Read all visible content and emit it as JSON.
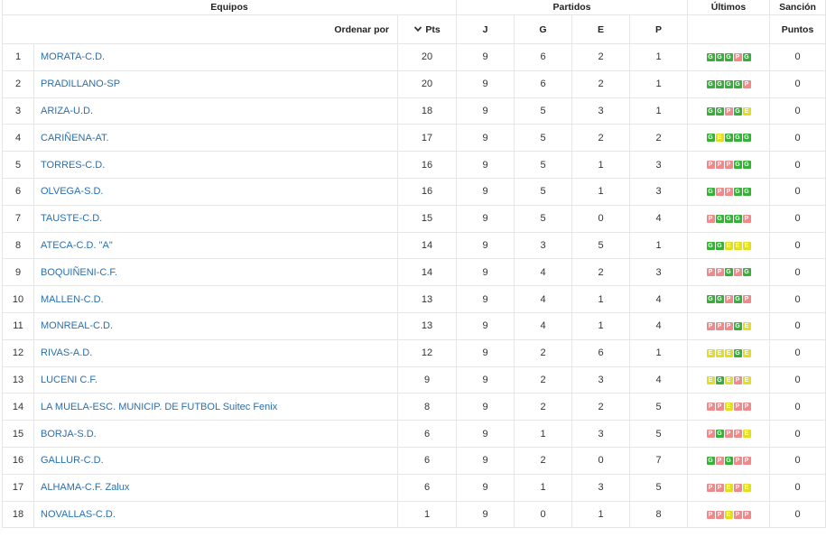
{
  "header": {
    "equipos": "Equipos",
    "partidos": "Partidos",
    "ultimos": "Últimos",
    "sancion": "Sanción",
    "ordenar_por": "Ordenar por",
    "pts": "Pts",
    "j": "J",
    "g": "G",
    "e": "E",
    "p": "P",
    "puntos": "Puntos"
  },
  "colors": {
    "G": "#35b135",
    "E": "#e2df22",
    "P": "#f08a8a",
    "link": "#2a6fae"
  },
  "rows": [
    {
      "pos": "1",
      "team": "MORATA-C.D.",
      "pts": "20",
      "j": "9",
      "g": "6",
      "e": "2",
      "p": "1",
      "last": "GGGPG",
      "sancion": "0"
    },
    {
      "pos": "2",
      "team": "PRADILLANO-SP",
      "pts": "20",
      "j": "9",
      "g": "6",
      "e": "2",
      "p": "1",
      "last": "GGGGP",
      "sancion": "0"
    },
    {
      "pos": "3",
      "team": "ARIZA-U.D.",
      "pts": "18",
      "j": "9",
      "g": "5",
      "e": "3",
      "p": "1",
      "last": "GGPGE",
      "sancion": "0"
    },
    {
      "pos": "4",
      "team": "CARIÑENA-AT.",
      "pts": "17",
      "j": "9",
      "g": "5",
      "e": "2",
      "p": "2",
      "last": "GEGGG",
      "sancion": "0"
    },
    {
      "pos": "5",
      "team": "TORRES-C.D.",
      "pts": "16",
      "j": "9",
      "g": "5",
      "e": "1",
      "p": "3",
      "last": "PPPGG",
      "sancion": "0"
    },
    {
      "pos": "6",
      "team": "OLVEGA-S.D.",
      "pts": "16",
      "j": "9",
      "g": "5",
      "e": "1",
      "p": "3",
      "last": "GPPGG",
      "sancion": "0"
    },
    {
      "pos": "7",
      "team": "TAUSTE-C.D.",
      "pts": "15",
      "j": "9",
      "g": "5",
      "e": "0",
      "p": "4",
      "last": "PGGGP",
      "sancion": "0"
    },
    {
      "pos": "8",
      "team": "ATECA-C.D. \"A\"",
      "pts": "14",
      "j": "9",
      "g": "3",
      "e": "5",
      "p": "1",
      "last": "GGEEE",
      "sancion": "0"
    },
    {
      "pos": "9",
      "team": "BOQUIÑENI-C.F.",
      "pts": "14",
      "j": "9",
      "g": "4",
      "e": "2",
      "p": "3",
      "last": "PPGPG",
      "sancion": "0"
    },
    {
      "pos": "10",
      "team": "MALLEN-C.D.",
      "pts": "13",
      "j": "9",
      "g": "4",
      "e": "1",
      "p": "4",
      "last": "GGPGP",
      "sancion": "0"
    },
    {
      "pos": "11",
      "team": "MONREAL-C.D.",
      "pts": "13",
      "j": "9",
      "g": "4",
      "e": "1",
      "p": "4",
      "last": "PPPGE",
      "sancion": "0"
    },
    {
      "pos": "12",
      "team": "RIVAS-A.D.",
      "pts": "12",
      "j": "9",
      "g": "2",
      "e": "6",
      "p": "1",
      "last": "EEEGE",
      "sancion": "0"
    },
    {
      "pos": "13",
      "team": "LUCENI C.F.",
      "pts": "9",
      "j": "9",
      "g": "2",
      "e": "3",
      "p": "4",
      "last": "EGEPE",
      "sancion": "0"
    },
    {
      "pos": "14",
      "team": "LA MUELA-ESC. MUNICIP. DE FUTBOL Suitec Fenix",
      "pts": "8",
      "j": "9",
      "g": "2",
      "e": "2",
      "p": "5",
      "last": "PPEPP",
      "sancion": "0"
    },
    {
      "pos": "15",
      "team": "BORJA-S.D.",
      "pts": "6",
      "j": "9",
      "g": "1",
      "e": "3",
      "p": "5",
      "last": "PGPPE",
      "sancion": "0"
    },
    {
      "pos": "16",
      "team": "GALLUR-C.D.",
      "pts": "6",
      "j": "9",
      "g": "2",
      "e": "0",
      "p": "7",
      "last": "GPGPP",
      "sancion": "0"
    },
    {
      "pos": "17",
      "team": "ALHAMA-C.F. Zalux",
      "pts": "6",
      "j": "9",
      "g": "1",
      "e": "3",
      "p": "5",
      "last": "PPEPE",
      "sancion": "0"
    },
    {
      "pos": "18",
      "team": "NOVALLAS-C.D.",
      "pts": "1",
      "j": "9",
      "g": "0",
      "e": "1",
      "p": "8",
      "last": "PPEPP",
      "sancion": "0"
    }
  ]
}
